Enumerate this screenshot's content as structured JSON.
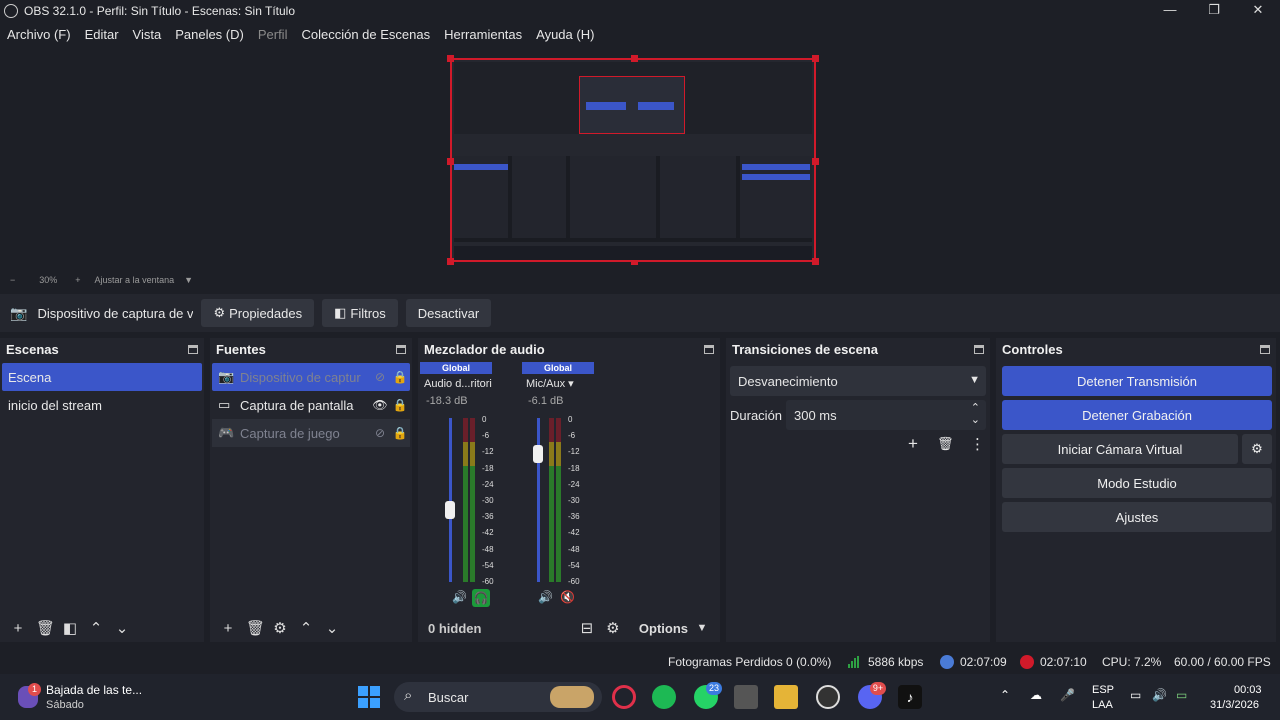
{
  "window": {
    "title": "OBS 32.1.0 - Perfil: Sin Título - Escenas: Sin Título",
    "controls": {
      "minimize": "—",
      "maximize": "❐",
      "close": "✕"
    }
  },
  "menu": [
    "Archivo (F)",
    "Editar",
    "Vista",
    "Paneles (D)",
    "Perfil",
    "Colección de Escenas",
    "Herramientas",
    "Ayuda (H)"
  ],
  "preview": {
    "zoom_minus": "−",
    "zoom": "30%",
    "zoom_plus": "+",
    "fit": "Ajustar a la ventana",
    "fit_icon": "▼"
  },
  "source_toolbar": {
    "camera_icon": "📷",
    "source_name": "Dispositivo de captura de v",
    "properties": "Propiedades",
    "properties_icon": "⚙",
    "filters": "Filtros",
    "filters_icon": "◧",
    "deactivate": "Desactivar"
  },
  "scenes": {
    "title": "Escenas",
    "items": [
      "Escena",
      "inicio del stream"
    ],
    "footer_icons": [
      "+",
      "🗑",
      "◧",
      "⌃",
      "⌄"
    ]
  },
  "sources": {
    "title": "Fuentes",
    "items": [
      {
        "icon": "📷",
        "label": "Dispositivo de captur",
        "visibility": "⊘",
        "lock": "🔒"
      },
      {
        "icon": "▭",
        "label": "Captura de pantalla",
        "visibility": "👁",
        "lock": "🔒"
      },
      {
        "icon": "🎮",
        "label": "Captura de juego",
        "visibility": "⊘",
        "lock": "🔒"
      }
    ],
    "footer_icons": [
      "+",
      "🗑",
      "⚙",
      "⌃",
      "⌄"
    ]
  },
  "mixer": {
    "title": "Mezclador de audio",
    "channels": [
      {
        "global": "Global",
        "name": "Audio d...ritorio",
        "db": "-18.3 dB",
        "level": 0.44
      },
      {
        "global": "Global",
        "name": "Mic/Aux",
        "db": "-6.1 dB",
        "level": 0.78
      }
    ],
    "scale": [
      "0",
      "-6",
      "-12",
      "-18",
      "-24",
      "-30",
      "-36",
      "-42",
      "-48",
      "-54",
      "-60"
    ],
    "volume_icon": "🔊",
    "monitor_icon": "🎧",
    "mute_icon": "🔇",
    "hidden": "0 hidden",
    "options": "Options",
    "options_arrow": "▼",
    "layout_icon": "⊟",
    "settings_icon": "⚙"
  },
  "transitions": {
    "title": "Transiciones de escena",
    "current": "Desvanecimiento",
    "arrow": "▼",
    "duration_label": "Duración",
    "duration_value": "300 ms",
    "up": "⌃",
    "down": "⌄",
    "add_icon": "+",
    "delete_icon": "🗑",
    "more_icon": "⋮"
  },
  "controls": {
    "title": "Controles",
    "stop_stream": "Detener Transmisión",
    "stop_record": "Detener Grabación",
    "virtual_cam": "Iniciar Cámara Virtual",
    "studio": "Modo Estudio",
    "settings": "Ajustes",
    "gear_icon": "⚙"
  },
  "status": {
    "dropped": "Fotogramas Perdidos 0 (0.0%)",
    "bitrate": "5886 kbps",
    "stream_time": "02:07:09",
    "rec_time": "02:07:10",
    "cpu": "CPU: 7.2%",
    "fps": "60.00 / 60.00 FPS",
    "colors": {
      "bitrate": "#2ea043",
      "record": "#d11a2a",
      "stream": "#4a7bd6"
    }
  },
  "taskbar": {
    "weather_title": "Bajada de las te...",
    "weather_sub": "Sábado",
    "weather_badge": "1",
    "search": "Buscar",
    "lang1": "ESP",
    "lang2": "LAA",
    "time": "00:03",
    "date": "31/3/2026",
    "chevron": "⌃",
    "whatsapp_badge": "23",
    "discord_badge": "9+"
  }
}
